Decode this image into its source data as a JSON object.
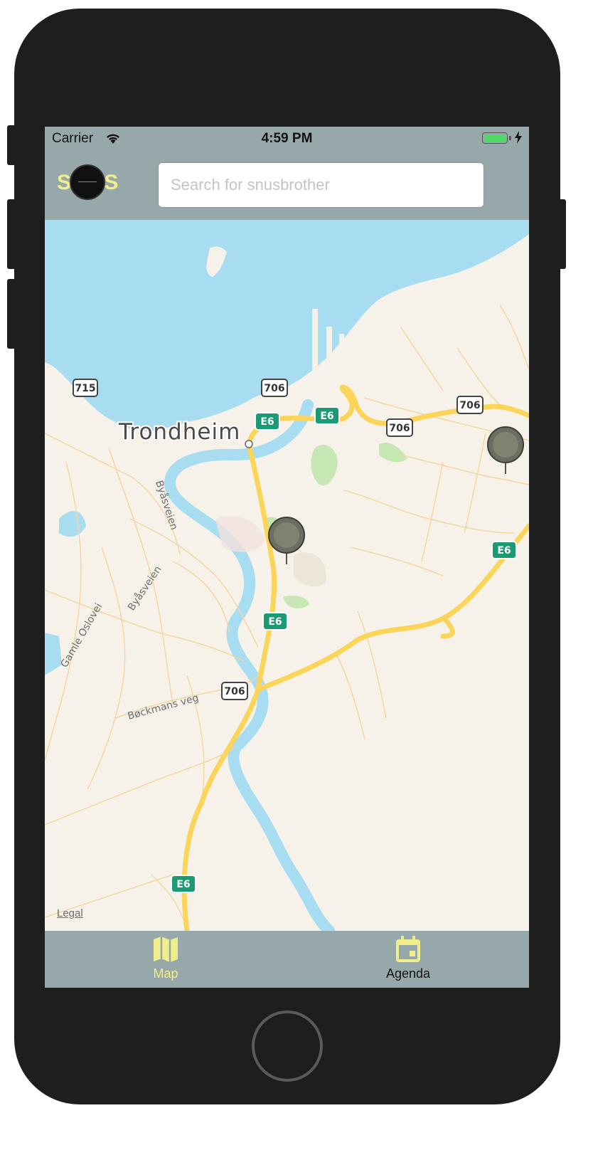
{
  "status_bar": {
    "carrier": "Carrier",
    "time": "4:59 PM",
    "battery_color": "#4cd964"
  },
  "header": {
    "logo_text": "SNUS",
    "search_placeholder": "Search for snusbrother",
    "search_value": ""
  },
  "map": {
    "city_label": "Trondheim",
    "road_shields": [
      "715",
      "706",
      "706",
      "706",
      "706",
      "E6",
      "E6",
      "E6",
      "E6",
      "E6"
    ],
    "street_labels": [
      "Byåsveien",
      "Byåsveien",
      "Gamle Oslovei",
      "Bøckmans veg"
    ],
    "legal_label": "Legal",
    "pin_count": 2
  },
  "tab_bar": {
    "tabs": [
      {
        "label": "Map",
        "icon": "map-icon",
        "active": true
      },
      {
        "label": "Agenda",
        "icon": "calendar-icon",
        "active": false
      }
    ],
    "active_color": "#f0ee8a",
    "inactive_color": "#111111"
  },
  "colors": {
    "bar_background": "#97a8ab",
    "water": "#a8dcf0",
    "land": "#f6f2ea",
    "highway": "#fbd45a",
    "shield_green": "#1a9b73"
  }
}
